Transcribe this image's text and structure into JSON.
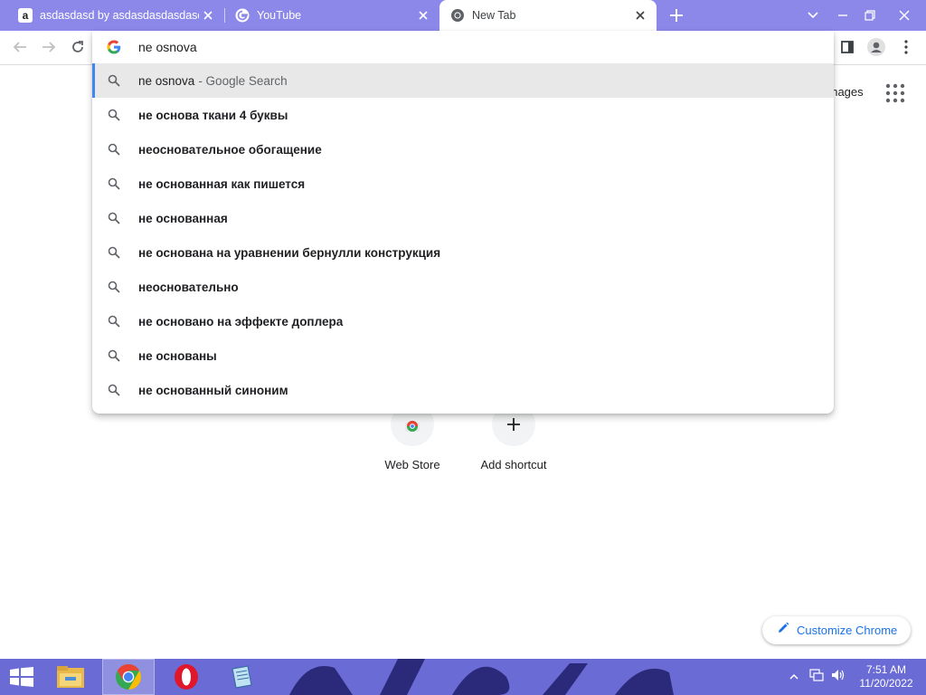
{
  "tabs": [
    {
      "title": "asdasdasd by asdasdasdasdasd on Amazon",
      "favicon": "amazon-icon",
      "active": false
    },
    {
      "title": "YouTube",
      "favicon": "google-icon",
      "active": false
    },
    {
      "title": "New Tab",
      "favicon": "chrome-icon",
      "active": true
    }
  ],
  "omnibox": {
    "query": "ne osnova",
    "suggestions": [
      {
        "text": "ne osnova",
        "suffix": "- Google Search",
        "selected": true
      },
      {
        "text": "не основа ткани 4 буквы"
      },
      {
        "text": "неосновательное обогащение"
      },
      {
        "text": "не основанная как пишется"
      },
      {
        "text": "не основанная"
      },
      {
        "text": "не основана на уравнении бернулли конструкция"
      },
      {
        "text": "неосновательно"
      },
      {
        "text": "не основано на эффекте доплера"
      },
      {
        "text": "не основаны"
      },
      {
        "text": "не основанный синоним"
      }
    ]
  },
  "ntp": {
    "images_link": "Images",
    "shortcuts": [
      {
        "label": "Web Store",
        "icon": "chrome-web-store-icon"
      },
      {
        "label": "Add shortcut",
        "icon": "plus-icon"
      }
    ],
    "customize_label": "Customize Chrome"
  },
  "taskbar": {
    "apps": [
      "file-explorer-icon",
      "chrome-icon",
      "opera-icon",
      "notepad-icon"
    ],
    "time": "7:51 AM",
    "date": "11/20/2022"
  },
  "colors": {
    "tabstrip": "#8c88ea",
    "accent": "#1a73e8",
    "selection_bar": "#4285f4",
    "taskbar": "#6b6bd6"
  }
}
